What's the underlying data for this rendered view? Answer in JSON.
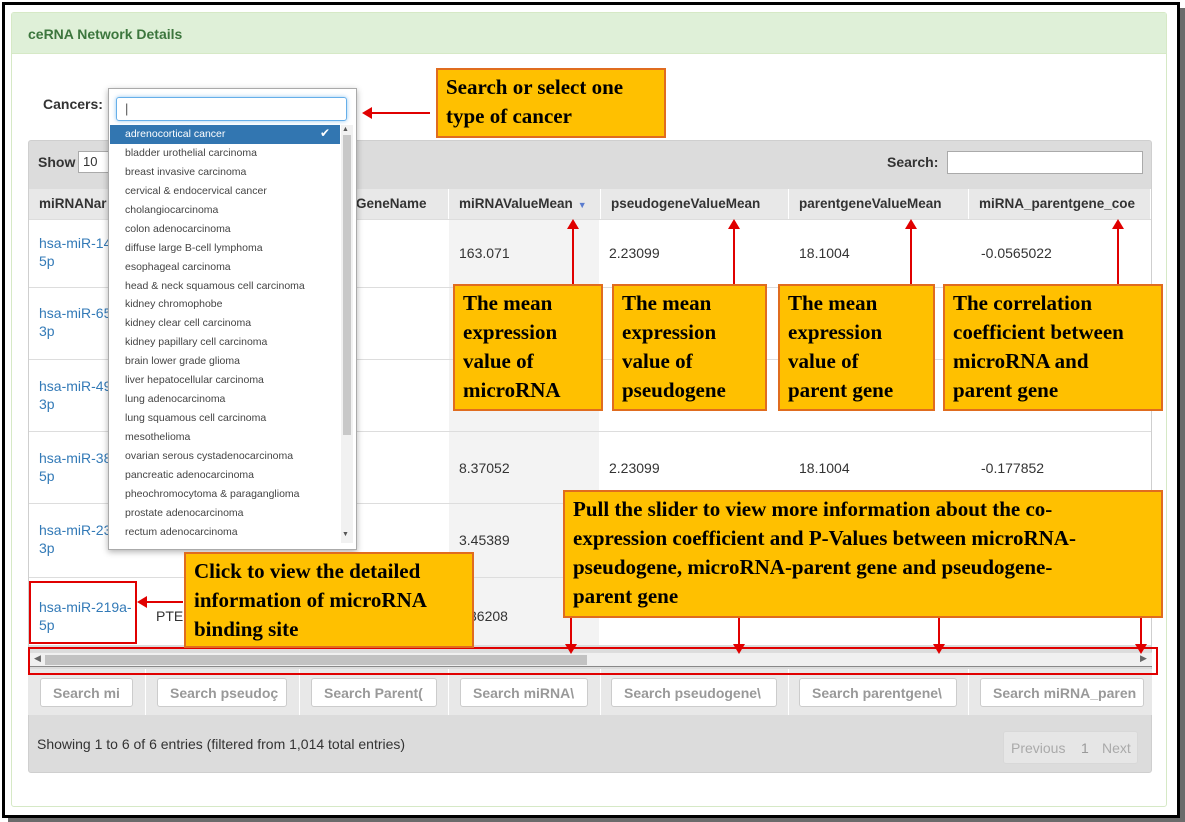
{
  "panel": {
    "title": "ceRNA Network Details"
  },
  "filter": {
    "cancers_label": "Cancers:"
  },
  "table_controls": {
    "show_label": "Show",
    "show_value": "10",
    "search_label": "Search:"
  },
  "columns": [
    "miRNANar",
    "GeneName",
    "miRNAValueMean",
    "pseudogeneValueMean",
    "parentgeneValueMean",
    "miRNA_parentgene_coe"
  ],
  "rows": [
    {
      "mirna_line1": "hsa-miR-14",
      "mirna_line2": "5p",
      "mirna_mean": "163.071",
      "pseudo_mean": "2.23099",
      "parent_mean": "18.1004",
      "coe": "-0.0565022"
    },
    {
      "mirna_line1": "hsa-miR-65",
      "mirna_line2": "3p"
    },
    {
      "mirna_line1": "hsa-miR-49",
      "mirna_line2": "3p"
    },
    {
      "mirna_line1": "hsa-miR-38",
      "mirna_line2": "5p",
      "mirna_mean": "8.37052",
      "pseudo_mean": "2.23099",
      "parent_mean": "18.1004",
      "coe": "-0.177852"
    },
    {
      "mirna_line1": "hsa-miR-23",
      "mirna_line2": "3p",
      "mirna_mean": "3.45389"
    },
    {
      "mirna_line1": "hsa-miR-219a-",
      "mirna_line2": "5p",
      "gene_partial": "PTE",
      "mirna_mean_partial": "36208"
    }
  ],
  "column_filters": [
    "Search mi",
    "Search pseudoç",
    "Search Parent(",
    "Search miRNA\\",
    "Search pseudogene\\",
    "Search parentgene\\",
    "Search miRNA_paren"
  ],
  "info": "Showing 1 to 6 of 6 entries (filtered from 1,014 total entries)",
  "pagination": {
    "previous": "Previous",
    "page": "1",
    "next": "Next"
  },
  "dropdown": {
    "search_value": "|",
    "selected_index": 0,
    "options": [
      "adrenocortical cancer",
      "bladder urothelial carcinoma",
      "breast invasive carcinoma",
      "cervical & endocervical cancer",
      "cholangiocarcinoma",
      "colon adenocarcinoma",
      "diffuse large B-cell lymphoma",
      "esophageal carcinoma",
      "head & neck squamous cell carcinoma",
      "kidney chromophobe",
      "kidney clear cell carcinoma",
      "kidney papillary cell carcinoma",
      "brain lower grade glioma",
      "liver hepatocellular carcinoma",
      "lung adenocarcinoma",
      "lung squamous cell carcinoma",
      "mesothelioma",
      "ovarian serous cystadenocarcinoma",
      "pancreatic adenocarcinoma",
      "pheochromocytoma & paraganglioma",
      "prostate adenocarcinoma",
      "rectum adenocarcinoma"
    ],
    "check_icon": "checkmark-icon"
  },
  "annotations": {
    "select_cancer_l1": "Search or select one",
    "select_cancer_l2": "type of cancer",
    "mirna_mean": [
      "The mean",
      "expression",
      "value of",
      "microRNA"
    ],
    "pseudo_mean": [
      "The mean",
      "expression",
      "value of",
      "pseudogene"
    ],
    "parent_mean": [
      "The mean",
      "expression",
      "value of",
      "parent gene"
    ],
    "correlation": [
      "The correlation",
      "coefficient between",
      "microRNA and",
      "parent gene"
    ],
    "slider": [
      "Pull the slider to view more information about the co-",
      "expression coefficient and P-Values between microRNA-",
      "pseudogene, microRNA-parent gene and pseudogene-",
      "parent gene"
    ],
    "binding": [
      "Click to view the detailed",
      "information of microRNA",
      "binding site"
    ]
  },
  "colors": {
    "accent_red": "#e00000",
    "callout_fill": "#ffc000",
    "callout_border": "#e06c1f",
    "link": "#337ab7",
    "panel_head": "#dff0d8",
    "selected_option": "#3276b1"
  }
}
